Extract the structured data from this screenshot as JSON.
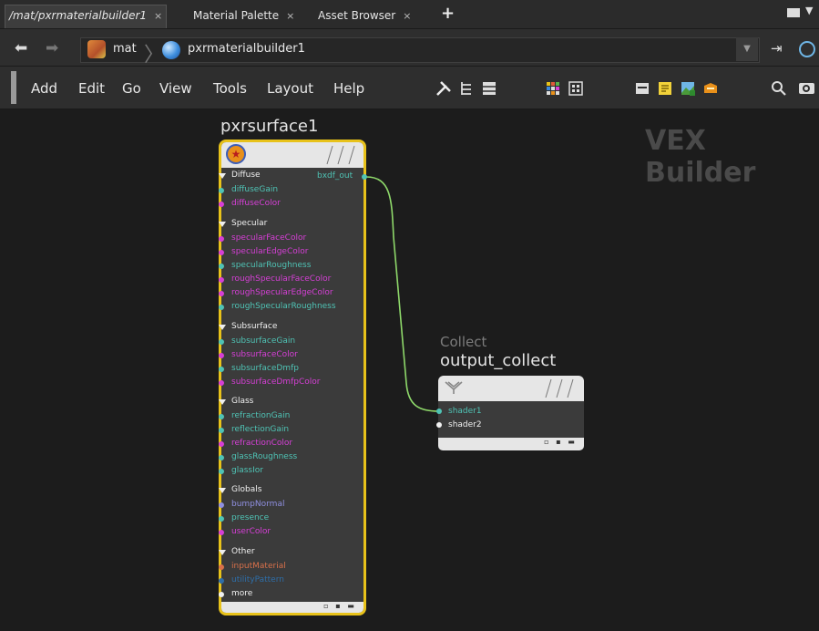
{
  "tabs": [
    {
      "label": "/mat/pxrmaterialbuilder1",
      "close": "×",
      "active": true
    },
    {
      "label": "Material Palette",
      "close": "×",
      "active": false
    },
    {
      "label": "Asset Browser",
      "close": "×",
      "active": false
    }
  ],
  "tabbar": {
    "add": "+"
  },
  "path": {
    "segments": [
      "mat",
      "pxrmaterialbuilder1"
    ],
    "dropdown": "▼"
  },
  "menu": [
    "Add",
    "Edit",
    "Go",
    "View",
    "Tools",
    "Layout",
    "Help"
  ],
  "network": {
    "watermark": "VEX Builder",
    "node1": {
      "name": "pxrsurface1",
      "output": "bxdf_out",
      "groups": [
        {
          "label": "Diffuse",
          "ports": [
            "diffuseGain",
            "diffuseColor"
          ]
        },
        {
          "label": "Specular",
          "ports": [
            "specularFaceColor",
            "specularEdgeColor",
            "specularRoughness",
            "roughSpecularFaceColor",
            "roughSpecularEdgeColor",
            "roughSpecularRoughness"
          ]
        },
        {
          "label": "Subsurface",
          "ports": [
            "subsurfaceGain",
            "subsurfaceColor",
            "subsurfaceDmfp",
            "subsurfaceDmfpColor"
          ]
        },
        {
          "label": "Glass",
          "ports": [
            "refractionGain",
            "reflectionGain",
            "refractionColor",
            "glassRoughness",
            "glassIor"
          ]
        },
        {
          "label": "Globals",
          "ports": [
            "bumpNormal",
            "presence",
            "userColor"
          ]
        },
        {
          "label": "Other",
          "ports": [
            "inputMaterial",
            "utilityPattern",
            "more"
          ]
        }
      ]
    },
    "node2": {
      "type": "Collect",
      "name": "output_collect",
      "inputs": [
        "shader1",
        "shader2"
      ]
    }
  },
  "colors": {
    "float": "#4fc3b5",
    "color": "#d63fd6",
    "normal": "#8f8fe0",
    "struct": "#d8704a",
    "utility": "#2e6ea8",
    "generic": "#f0f0f0",
    "selection": "#e8c21a",
    "wire": "#8ed86a"
  }
}
